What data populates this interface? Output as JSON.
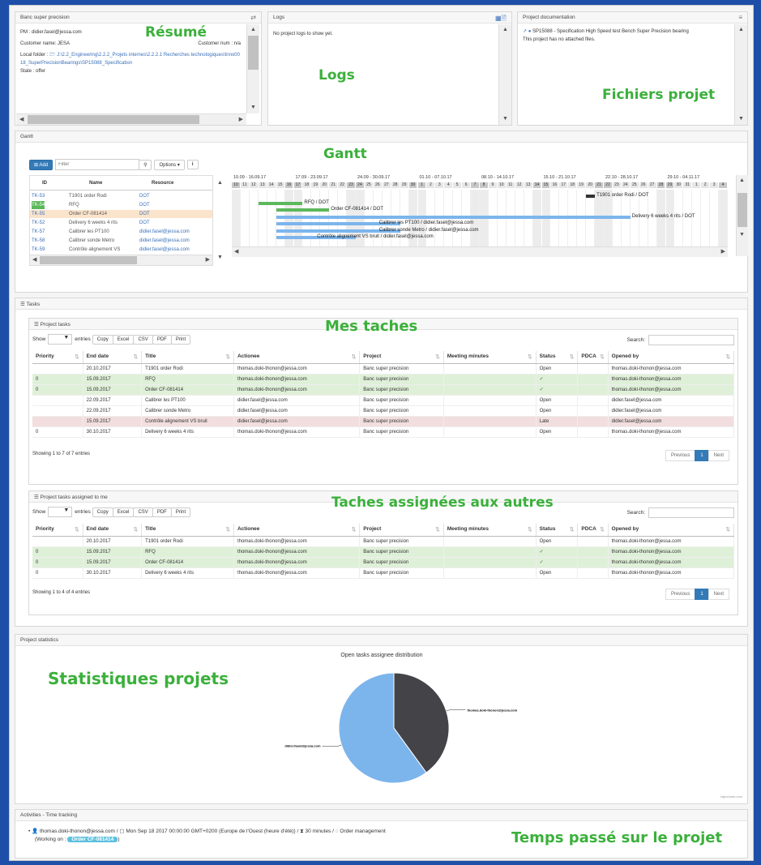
{
  "annotations": {
    "resume": "Résumé",
    "logs": "Logs",
    "fichiers": "Fichiers projet",
    "gantt": "Gantt",
    "mes_taches": "Mes taches",
    "taches_autres": "Taches assignées aux autres",
    "statistiques": "Statistiques projets",
    "temps": "Temps passé sur le projet"
  },
  "summary": {
    "title": "Banc super precision",
    "pm": "PM : didier.fasel@jessa.com",
    "customer_name": "Customer name: JESA",
    "customer_num": "Customer num : n/a",
    "local_folder_label": "Local folder :",
    "local_folder_path": "J:\\2.2_Engineering\\2.2.2_Projets internes\\2.2.2.1 Recherches technologiques\\Inno0018_SuperPrecisionBearings\\SP15088_Specification",
    "state": "State : offer"
  },
  "logs": {
    "title": "Logs",
    "empty": "No project logs to show yet."
  },
  "docs": {
    "title": "Project documentation",
    "item": "SP15088 - Specification High Speed test Bench Super Precision bearing",
    "no_files": "This project has no attached files."
  },
  "gantt": {
    "title": "Gantt",
    "add": "Add",
    "filter_placeholder": "Filter",
    "options": "Options",
    "info": "i",
    "cols": [
      "ID",
      "Name",
      "Resource"
    ],
    "rows": [
      {
        "id": "TK-53",
        "name": "T1901 order Rodi",
        "res": "DOT",
        "hl": ""
      },
      {
        "id": "TK-54",
        "name": "RFQ",
        "res": "DOT",
        "hl": "g"
      },
      {
        "id": "TK-55",
        "name": "Order CF-081414",
        "res": "DOT",
        "hl": "o"
      },
      {
        "id": "TK-52",
        "name": "Delivery 6 weeks 4 rits",
        "res": "DOT",
        "hl": ""
      },
      {
        "id": "TK-57",
        "name": "Calibrer les PT100",
        "res": "didier.fasel@jessa.com",
        "hl": ""
      },
      {
        "id": "TK-58",
        "name": "Calibrer sonde Metro",
        "res": "didier.fasel@jessa.com",
        "hl": ""
      },
      {
        "id": "TK-59",
        "name": "Contrôle alignement VS",
        "res": "didier.fasel@jessa.com",
        "hl": ""
      }
    ],
    "weeks": [
      "10.09 - 16.09.17",
      "17.09 - 23.09.17",
      "24.09 - 30.09.17",
      "01.10 - 07.10.17",
      "08.10 - 14.10.17",
      "15.10 - 21.10.17",
      "22.10 - 28.10.17",
      "29.10 - 04.11.17"
    ],
    "days": [
      "10",
      "11",
      "12",
      "13",
      "14",
      "15",
      "16",
      "17",
      "18",
      "19",
      "20",
      "21",
      "22",
      "23",
      "24",
      "25",
      "26",
      "27",
      "28",
      "29",
      "30",
      "1",
      "2",
      "3",
      "4",
      "5",
      "6",
      "7",
      "8",
      "9",
      "10",
      "11",
      "12",
      "13",
      "14",
      "15",
      "16",
      "17",
      "18",
      "19",
      "20",
      "21",
      "22",
      "23",
      "24",
      "25",
      "26",
      "27",
      "28",
      "29",
      "30",
      "31",
      "1",
      "2",
      "3",
      "4"
    ],
    "bar_labels": [
      "T1901 order Rodi / DOT",
      "RFQ / DOT",
      "Order CF-081414 / DOT",
      "Delivery 6 weeks 4 rits / DOT",
      "Calibrer les PT100 / didier.fasel@jessa.com",
      "Calibrer sonde Metro / didier.fasel@jessa.com",
      "Contrôle alignement VS bruit / didier.fasel@jessa.com"
    ]
  },
  "tasks_header": "Tasks",
  "project_tasks": {
    "title": "Project tasks",
    "show": "Show",
    "entries": "entries",
    "buttons": [
      "Copy",
      "Excel",
      "CSV",
      "PDF",
      "Print"
    ],
    "search": "Search:",
    "columns": [
      "Priority",
      "End date",
      "Title",
      "Actionee",
      "Project",
      "Meeting minutes",
      "Status",
      "PDCA",
      "Opened by"
    ],
    "rows": [
      {
        "p": "",
        "d": "20.10.2017",
        "t": "T1901 order Rodi",
        "a": "thomas.doki-thonon@jessa.com",
        "pr": "Banc super precision",
        "m": "",
        "s": "Open",
        "c": "",
        "o": "thomas.doki-thonon@jessa.com",
        "cls": ""
      },
      {
        "p": "0",
        "d": "15.09.2017",
        "t": "RFQ",
        "a": "thomas.doki-thonon@jessa.com",
        "pr": "Banc super precision",
        "m": "",
        "s": "✓",
        "c": "",
        "o": "thomas.doki-thonon@jessa.com",
        "cls": "g"
      },
      {
        "p": "0",
        "d": "15.09.2017",
        "t": "Order CF-081414",
        "a": "thomas.doki-thonon@jessa.com",
        "pr": "Banc super precision",
        "m": "",
        "s": "✓",
        "c": "",
        "o": "thomas.doki-thonon@jessa.com",
        "cls": "g"
      },
      {
        "p": "",
        "d": "22.09.2017",
        "t": "Calibrer les PT100",
        "a": "didier.fasel@jessa.com",
        "pr": "Banc super precision",
        "m": "",
        "s": "Open",
        "c": "",
        "o": "didier.fasel@jessa.com",
        "cls": ""
      },
      {
        "p": "",
        "d": "22.09.2017",
        "t": "Calibrer sonde Metro",
        "a": "didier.fasel@jessa.com",
        "pr": "Banc super precision",
        "m": "",
        "s": "Open",
        "c": "",
        "o": "didier.fasel@jessa.com",
        "cls": ""
      },
      {
        "p": "",
        "d": "15.09.2017",
        "t": "Contrôle alignement VS bruit",
        "a": "didier.fasel@jessa.com",
        "pr": "Banc super precision",
        "m": "",
        "s": "Late",
        "c": "",
        "o": "didier.fasel@jessa.com",
        "cls": "r"
      },
      {
        "p": "0",
        "d": "30.10.2017",
        "t": "Delivery 6 weeks 4 rits",
        "a": "thomas.doki-thonon@jessa.com",
        "pr": "Banc super precision",
        "m": "",
        "s": "Open",
        "c": "",
        "o": "thomas.doki-thonon@jessa.com",
        "cls": ""
      }
    ],
    "info": "Showing 1 to 7 of 7 entries",
    "prev": "Previous",
    "page": "1",
    "next": "Next"
  },
  "assigned_tasks": {
    "title": "Project tasks assigned to me",
    "show": "Show",
    "entries": "entries",
    "buttons": [
      "Copy",
      "Excel",
      "CSV",
      "PDF",
      "Print"
    ],
    "search": "Search:",
    "columns": [
      "Priority",
      "End date",
      "Title",
      "Actionee",
      "Project",
      "Meeting minutes",
      "Status",
      "PDCA",
      "Opened by"
    ],
    "rows": [
      {
        "p": "",
        "d": "20.10.2017",
        "t": "T1901 order Rodi",
        "a": "thomas.doki-thonon@jessa.com",
        "pr": "Banc super precision",
        "m": "",
        "s": "Open",
        "c": "",
        "o": "thomas.doki-thonon@jessa.com",
        "cls": ""
      },
      {
        "p": "0",
        "d": "15.09.2017",
        "t": "RFQ",
        "a": "thomas.doki-thonon@jessa.com",
        "pr": "Banc super precision",
        "m": "",
        "s": "✓",
        "c": "",
        "o": "thomas.doki-thonon@jessa.com",
        "cls": "g"
      },
      {
        "p": "0",
        "d": "15.09.2017",
        "t": "Order CF-081414",
        "a": "thomas.doki-thonon@jessa.com",
        "pr": "Banc super precision",
        "m": "",
        "s": "✓",
        "c": "",
        "o": "thomas.doki-thonon@jessa.com",
        "cls": "g"
      },
      {
        "p": "0",
        "d": "30.10.2017",
        "t": "Delivery 6 weeks 4 rits",
        "a": "thomas.doki-thonon@jessa.com",
        "pr": "Banc super precision",
        "m": "",
        "s": "Open",
        "c": "",
        "o": "thomas.doki-thonon@jessa.com",
        "cls": ""
      }
    ],
    "info": "Showing 1 to 4 of 4 entries",
    "prev": "Previous",
    "page": "1",
    "next": "Next"
  },
  "statistics": {
    "title": "Project statistics",
    "credit": "highcharts.com"
  },
  "chart_data": {
    "type": "pie",
    "title": "Open tasks assignee distribution",
    "labels": [
      "thomas.doki-thonon@jessa.com",
      "didier.fasel@jessa.com"
    ],
    "values": [
      2,
      3
    ],
    "colors": [
      "#434348",
      "#7cb5ec"
    ]
  },
  "activities": {
    "title": "Activities - Time tracking",
    "user": "thomas.doki-thonon@jessa.com",
    "date": "Mon Sep 18 2017 00:00:00 GMT+0200 (Europe de l'Ouest (heure d'été))",
    "duration": "30 minutes",
    "category": "Order management",
    "working_on": "(Working on :",
    "badge": "Order CF-081414",
    "close": ")"
  }
}
